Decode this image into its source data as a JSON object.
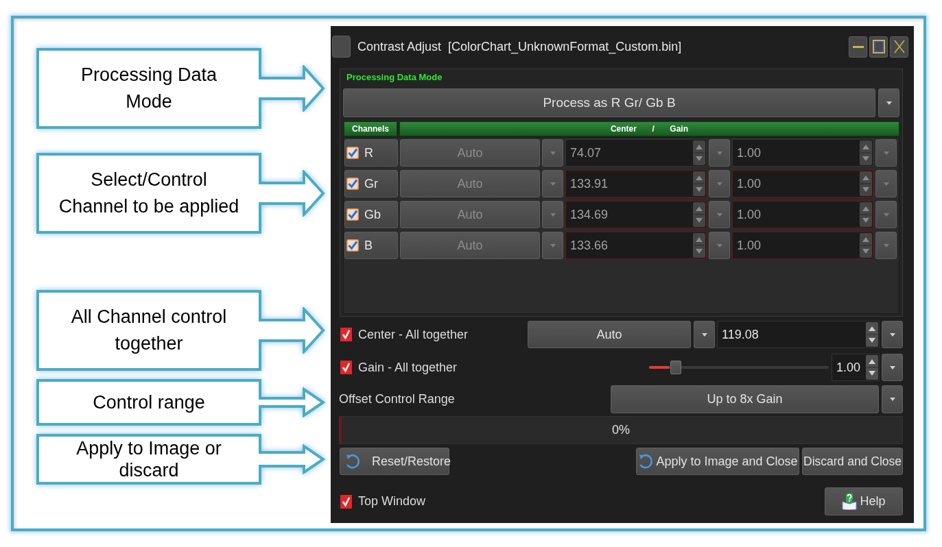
{
  "callouts": [
    {
      "text": "Processing Data\nMode"
    },
    {
      "text": "Select/Control\nChannel to be applied"
    },
    {
      "text": "All Channel control\ntogether"
    },
    {
      "text": "Control range"
    },
    {
      "text": "Apply to Image or\ndiscard"
    }
  ],
  "window": {
    "title": "Contrast Adjust  [ColorChart_UnknownFormat_Custom.bin]"
  },
  "processing_mode": {
    "label": "Processing Data Mode",
    "value": "Process as R Gr/ Gb B"
  },
  "channel_table": {
    "columns": [
      "Channels",
      "Center / Gain"
    ]
  },
  "channels": [
    {
      "name": "R",
      "checked": true,
      "disabled": true,
      "outlined": false,
      "mode": "Auto",
      "center": "74.07",
      "gain": "1.00"
    },
    {
      "name": "Gr",
      "checked": true,
      "disabled": true,
      "outlined": true,
      "mode": "Auto",
      "center": "133.91",
      "gain": "1.00"
    },
    {
      "name": "Gb",
      "checked": true,
      "disabled": true,
      "outlined": true,
      "mode": "Auto",
      "center": "134.69",
      "gain": "1.00"
    },
    {
      "name": "B",
      "checked": true,
      "disabled": true,
      "outlined": true,
      "mode": "Auto",
      "center": "133.66",
      "gain": "1.00"
    }
  ],
  "center_all": {
    "label": "Center - All together",
    "checked": true,
    "mode": "Auto",
    "value": "119.08"
  },
  "gain_all": {
    "label": "Gain - All together",
    "checked": true,
    "level": 0.15,
    "value": "1.00"
  },
  "offset_range": {
    "label": "Offset Control Range",
    "value": "Up to 8x Gain"
  },
  "progress": {
    "level": 0,
    "text": "0%"
  },
  "reset_button": {
    "label": "Reset/Restore"
  },
  "apply_button": {
    "label": "Apply to Image and Close"
  },
  "discard_button": {
    "label": "Discard and Close"
  },
  "top_window": {
    "label": "Top Window",
    "checked": true
  },
  "help_button": {
    "label": "Help"
  }
}
